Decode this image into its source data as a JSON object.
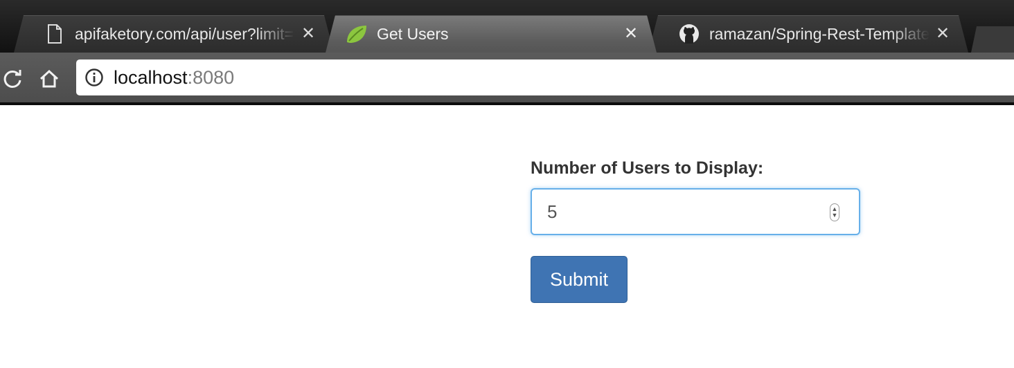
{
  "browser": {
    "tabs": [
      {
        "title": "apifaketory.com/api/user?limit=",
        "icon": "document-icon",
        "active": false
      },
      {
        "title": "Get Users",
        "icon": "spring-leaf-icon",
        "active": true
      },
      {
        "title": "ramazan/Spring-Rest-Template",
        "icon": "github-icon",
        "active": false
      }
    ],
    "close_glyph": "✕",
    "address": {
      "host": "localhost",
      "port": ":8080"
    }
  },
  "form": {
    "label": "Number of Users to Display:",
    "input_value": "5",
    "submit_label": "Submit"
  },
  "colors": {
    "primary_button": "#3f74b3",
    "focus_border": "#66afe9",
    "spring_green": "#8cc63f"
  }
}
